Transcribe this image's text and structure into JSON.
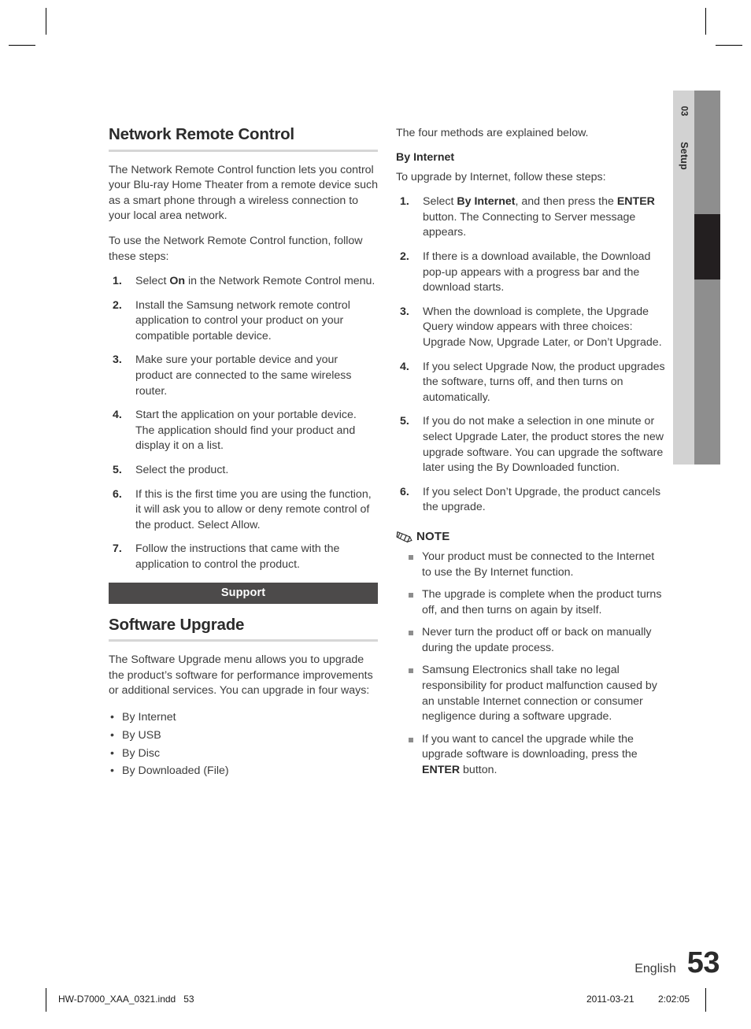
{
  "crop_marks": {
    "present": true
  },
  "side_tab": {
    "chapter_number": "03",
    "chapter_name": "Setup",
    "strip_color": "#d2d2d2",
    "bar_color": "#8e8e8e",
    "active_color": "#231f20"
  },
  "left_column": {
    "heading": "Network Remote Control",
    "intro": "The Network Remote Control function lets you control your Blu-ray Home Theater from a remote device such as a smart phone through a wireless connection to your local area network.",
    "intro2": "To use the Network Remote Control function, follow these steps:",
    "steps": [
      {
        "num": "1.",
        "pre": "Select ",
        "bold": "On",
        "post": " in the Network Remote Control menu."
      },
      {
        "num": "2.",
        "pre": "Install the Samsung network remote control application to control your product on your compatible portable device.",
        "bold": "",
        "post": ""
      },
      {
        "num": "3.",
        "pre": "Make sure your portable device and your product are connected to the same wireless router.",
        "bold": "",
        "post": ""
      },
      {
        "num": "4.",
        "pre": "Start the application on your portable device. The application should find your product and display it on a list.",
        "bold": "",
        "post": ""
      },
      {
        "num": "5.",
        "pre": "Select the product.",
        "bold": "",
        "post": ""
      },
      {
        "num": "6.",
        "pre": "If this is the first time you are using the function, it will ask you to allow or deny remote control of the product. Select Allow.",
        "bold": "",
        "post": ""
      },
      {
        "num": "7.",
        "pre": "Follow the instructions that came with the application to control the product.",
        "bold": "",
        "post": ""
      }
    ],
    "band_label": "Support",
    "subheading": "Software Upgrade",
    "upgrade_intro": "The Software Upgrade menu allows you to upgrade the product’s software for performance improvements or additional services. You can upgrade in four ways:",
    "methods": [
      "By Internet",
      "By USB",
      "By Disc",
      "By Downloaded (File)"
    ]
  },
  "right_column": {
    "lead": "The four methods are explained below.",
    "heading": "By Internet",
    "intro": "To upgrade by Internet, follow these steps:",
    "steps": [
      {
        "num": "1.",
        "pre": "Select ",
        "bold": "By Internet",
        "mid": ", and then press the ",
        "bold2": "ENTER",
        "post": " button. The Connecting to Server message appears."
      },
      {
        "num": "2.",
        "pre": "If there is a download available, the Download pop-up appears with a progress bar and the download starts.",
        "bold": "",
        "mid": "",
        "bold2": "",
        "post": ""
      },
      {
        "num": "3.",
        "pre": "When the download is complete, the Upgrade Query window appears with three choices: Upgrade Now, Upgrade Later, or Don’t Upgrade.",
        "bold": "",
        "mid": "",
        "bold2": "",
        "post": ""
      },
      {
        "num": "4.",
        "pre": "If you select Upgrade Now, the product upgrades the software, turns off, and then turns on automatically.",
        "bold": "",
        "mid": "",
        "bold2": "",
        "post": ""
      },
      {
        "num": "5.",
        "pre": "If you do not make a selection in one minute or select Upgrade Later, the product stores the new upgrade software. You can upgrade the software later using the By Downloaded function.",
        "bold": "",
        "mid": "",
        "bold2": "",
        "post": ""
      },
      {
        "num": "6.",
        "pre": "If you select Don’t Upgrade, the product cancels the upgrade.",
        "bold": "",
        "mid": "",
        "bold2": "",
        "post": ""
      }
    ],
    "note_label": "NOTE",
    "note_icon": "pencil-icon",
    "notes": [
      {
        "pre": "Your product must be connected to the Internet to use the By Internet function.",
        "bold": "",
        "post": ""
      },
      {
        "pre": "The upgrade is complete when the product turns off, and then turns on again by itself.",
        "bold": "",
        "post": ""
      },
      {
        "pre": "Never turn the product off or back on manually during the update process.",
        "bold": "",
        "post": ""
      },
      {
        "pre": "Samsung Electronics shall take no legal responsibility for product malfunction caused by an unstable Internet connection or consumer negligence during a software upgrade.",
        "bold": "",
        "post": ""
      },
      {
        "pre": "If you want to cancel the upgrade while the upgrade software is downloading, press the ",
        "bold": "ENTER",
        "post": " button."
      }
    ]
  },
  "footer": {
    "language": "English",
    "page_number": "53",
    "file_name": "HW-D7000_XAA_0321.indd",
    "file_page": "53",
    "date": "2011-03-21",
    "time": "2:02:05"
  }
}
